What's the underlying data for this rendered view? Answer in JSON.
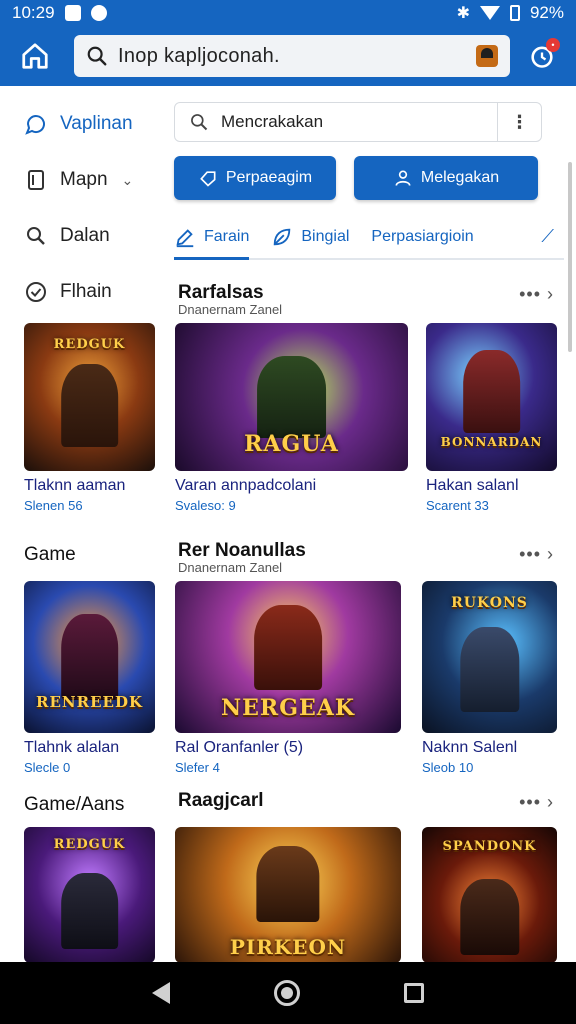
{
  "status": {
    "time": "10:29",
    "battery": "92%"
  },
  "header": {
    "search_query": "Inop kapljoconah."
  },
  "sidebar": {
    "items": [
      {
        "label": "Vaplinan",
        "icon": "chat-bubble-icon",
        "active": true
      },
      {
        "label": "Mapn",
        "icon": "phone-icon",
        "has_chevron": true
      },
      {
        "label": "Dalan",
        "icon": "search-icon"
      },
      {
        "label": "Flhain",
        "icon": "check-circle-icon"
      }
    ]
  },
  "filter": {
    "value": "Mencrakakan"
  },
  "actions": [
    {
      "label": "Perpaeagim",
      "icon": "tag-icon"
    },
    {
      "label": "Melegakan",
      "icon": "user-icon"
    }
  ],
  "tabs": [
    {
      "label": "Farain",
      "icon": "edit-icon",
      "active": true
    },
    {
      "label": "Bingial",
      "icon": "leaf-icon"
    },
    {
      "label": "Perpasiargioin",
      "icon": ""
    }
  ],
  "sections": [
    {
      "left_title": "",
      "title": "Rarfalsas",
      "subtitle": "Dnanernam Zanel",
      "more": "•••  ›",
      "cards": [
        {
          "banner": "REDGUK",
          "title": "Tlaknn aaman",
          "sub": "Slenen 56"
        },
        {
          "banner": "RAGUA",
          "title": "Varan annpadcolani",
          "sub": "Svaleso: 9"
        },
        {
          "banner": "BONNARDAN",
          "title": "Hakan salanl",
          "sub": "Scarent 33"
        }
      ]
    },
    {
      "left_title": "Game",
      "title": "Rer Noanullas",
      "subtitle": "Dnanernam Zanel",
      "more": "•••  ›",
      "cards": [
        {
          "banner": "RENREEDK",
          "title": "Tlahnk alalan",
          "sub": "Slecle 0"
        },
        {
          "banner": "NERGEAK",
          "title": "Ral Oranfanler (5)",
          "sub": "Slefer 4"
        },
        {
          "banner": "RUKONS",
          "title": "Naknn Salenl",
          "sub": "Sleob 10"
        }
      ]
    },
    {
      "left_title": "Game/Aans",
      "title": "Raagjcarl",
      "subtitle": "",
      "more": "•••  ›",
      "cards": [
        {
          "banner": "REDGUK",
          "title": "",
          "sub": ""
        },
        {
          "banner": "PIRKEON",
          "title": "",
          "sub": ""
        },
        {
          "banner": "SPANDONK",
          "title": "",
          "sub": ""
        }
      ]
    }
  ],
  "colors": {
    "brand": "#1565c0",
    "nav": "#000000"
  }
}
